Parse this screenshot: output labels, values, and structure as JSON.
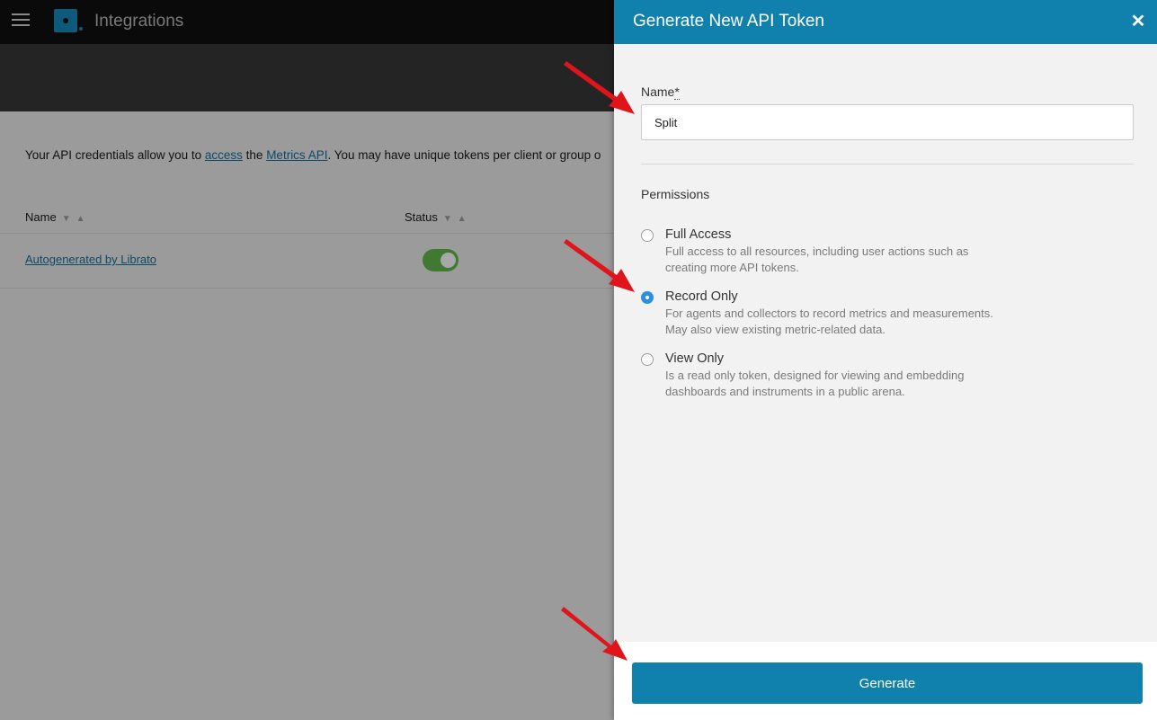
{
  "app": {
    "title": "Integrations",
    "description_before_link1": "Your API credentials allow you to ",
    "link1": "access",
    "description_between": " the ",
    "link2": "Metrics API",
    "description_after": ". You may have unique tokens per client or group o"
  },
  "table": {
    "columns": [
      "Name",
      "Status"
    ],
    "sort_arrows": "▼▲",
    "rows": [
      {
        "name": "Autogenerated by Librato",
        "status_on": true
      }
    ]
  },
  "panel": {
    "title": "Generate New API Token",
    "close": "✕",
    "name_label": "Name",
    "name_required": "*",
    "name_value": "Split",
    "permissions_heading": "Permissions",
    "options": [
      {
        "title": "Full Access",
        "desc": "Full access to all resources, including user actions such as creating more API tokens.",
        "checked": false
      },
      {
        "title": "Record Only",
        "desc": "For agents and collectors to record metrics and measurements. May also view existing metric-related data.",
        "checked": true
      },
      {
        "title": "View Only",
        "desc": "Is a read only token, designed for viewing and embedding dashboards and instruments in a public arena.",
        "checked": false
      }
    ],
    "generate_label": "Generate"
  },
  "colors": {
    "accent": "#1080ad",
    "annotation_arrow": "#e0141b",
    "toggle_on": "#3f7a30"
  }
}
